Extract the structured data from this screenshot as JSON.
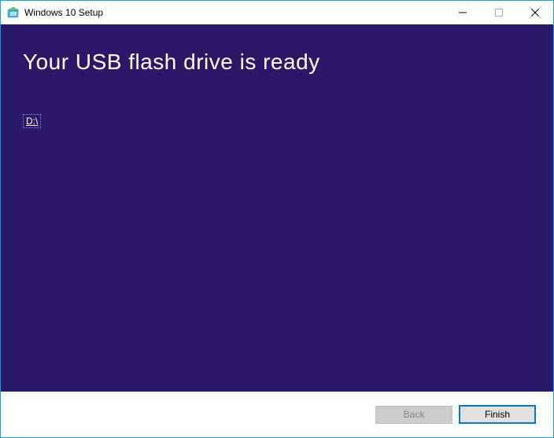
{
  "titlebar": {
    "title": "Windows 10 Setup"
  },
  "content": {
    "heading": "Your USB flash drive is ready",
    "drive_link": "D:\\"
  },
  "footer": {
    "back_label": "Back",
    "finish_label": "Finish"
  }
}
